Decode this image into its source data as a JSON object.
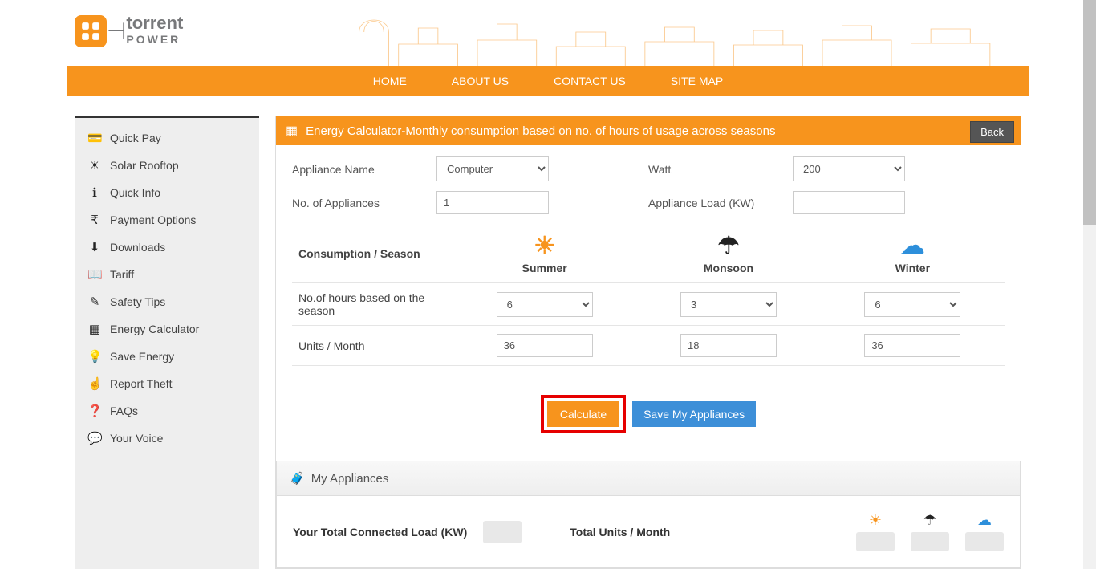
{
  "logo": {
    "brand": "torrent",
    "sub": "POWER"
  },
  "nav": {
    "home": "HOME",
    "about": "ABOUT US",
    "contact": "CONTACT US",
    "sitemap": "SITE MAP"
  },
  "sidebar": {
    "items": [
      {
        "label": "Quick Pay"
      },
      {
        "label": "Solar Rooftop"
      },
      {
        "label": "Quick Info"
      },
      {
        "label": "Payment Options"
      },
      {
        "label": "Downloads"
      },
      {
        "label": "Tariff"
      },
      {
        "label": "Safety Tips"
      },
      {
        "label": "Energy Calculator"
      },
      {
        "label": "Save Energy"
      },
      {
        "label": "Report Theft"
      },
      {
        "label": "FAQs"
      },
      {
        "label": "Your Voice"
      }
    ]
  },
  "panel": {
    "title": "Energy Calculator-Monthly consumption based on no. of hours of usage across seasons",
    "back": "Back"
  },
  "form": {
    "appliance_name_label": "Appliance Name",
    "appliance_name_value": "Computer",
    "watt_label": "Watt",
    "watt_value": "200",
    "no_appliances_label": "No. of Appliances",
    "no_appliances_value": "1",
    "load_label": "Appliance Load (KW)",
    "load_value": ""
  },
  "season": {
    "header": "Consumption / Season",
    "summer": "Summer",
    "monsoon": "Monsoon",
    "winter": "Winter",
    "hours_label": "No.of hours based on the season",
    "hours": {
      "summer": "6",
      "monsoon": "3",
      "winter": "6"
    },
    "units_label": "Units / Month",
    "units": {
      "summer": "36",
      "monsoon": "18",
      "winter": "36"
    }
  },
  "buttons": {
    "calculate": "Calculate",
    "save": "Save My Appliances"
  },
  "appliances": {
    "title": "My Appliances",
    "total_load_label": "Your Total Connected Load (KW)",
    "total_units_label": "Total Units / Month"
  }
}
